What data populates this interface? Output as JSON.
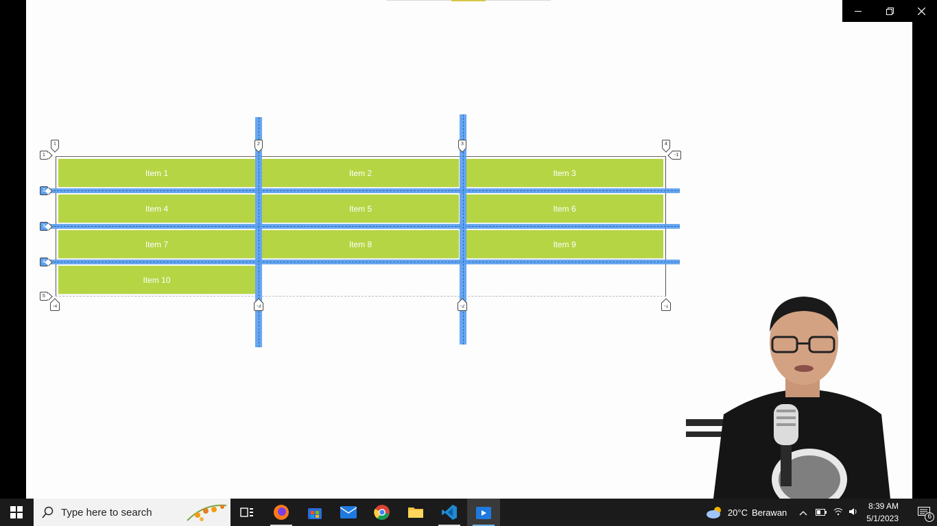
{
  "window": {
    "minimize_icon": "minimize-icon",
    "restore_icon": "restore-icon",
    "close_icon": "close-icon"
  },
  "grid": {
    "items": [
      "Item 1",
      "Item 2",
      "Item 3",
      "Item 4",
      "Item 5",
      "Item 6",
      "Item 7",
      "Item 8",
      "Item 9",
      "Item 10"
    ],
    "row_line_labels": [
      "1",
      "2",
      "3",
      "4",
      "5"
    ],
    "col_line_labels_top": [
      "1",
      "2",
      "3",
      "4"
    ],
    "col_line_labels_bottom": [
      "-4",
      "-3",
      "-2",
      "-1"
    ],
    "right_top_label": "-1",
    "colors": {
      "item": "#b5d544",
      "highlight": "#5a9ff0"
    }
  },
  "taskbar": {
    "search_placeholder": "Type here to search",
    "apps": [
      "task-view-icon",
      "firefox-icon",
      "store-icon",
      "mail-icon",
      "chrome-icon",
      "file-explorer-icon",
      "vscode-icon",
      "media-player-icon"
    ],
    "weather": {
      "temp": "20°C",
      "condition": "Berawan"
    },
    "clock": {
      "time": "8:39 AM",
      "date": "5/1/2023"
    },
    "notifications": "6"
  }
}
